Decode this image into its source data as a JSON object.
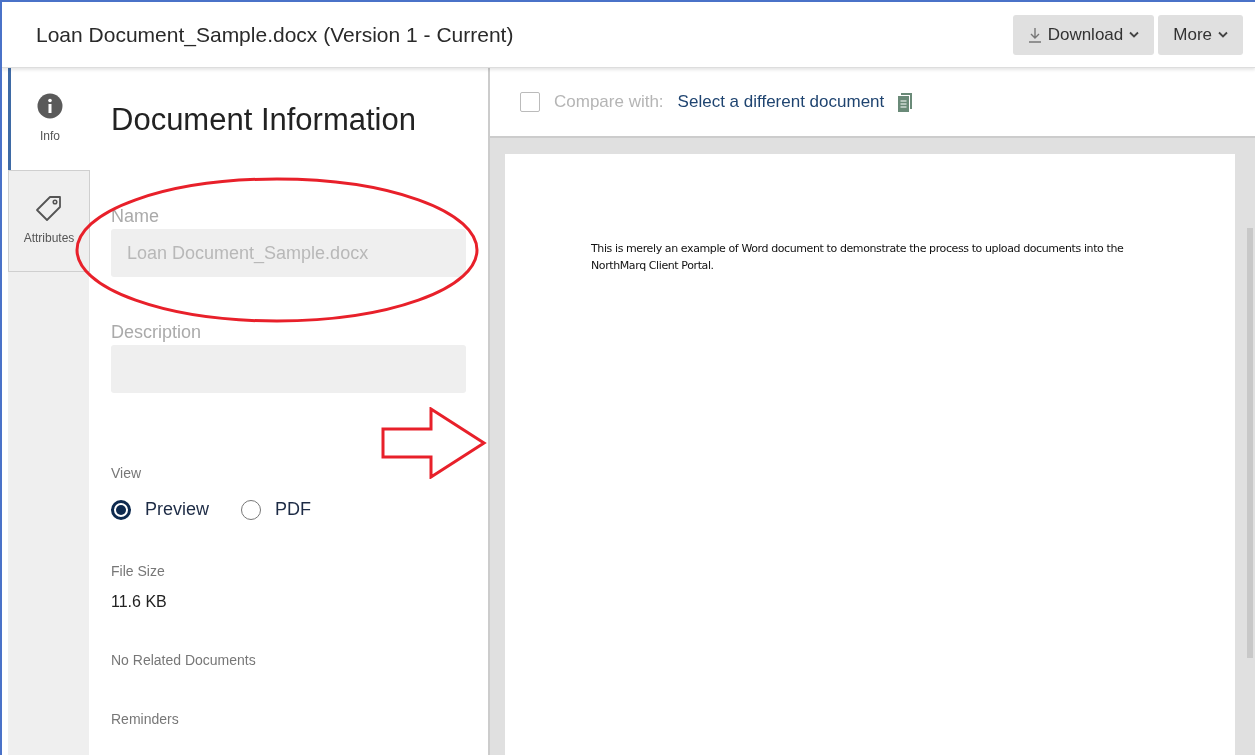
{
  "window": {
    "title": "Loan Document_Sample.docx (Version 1 - Current)"
  },
  "toolbar": [
    {
      "label": "Download",
      "kind": "download"
    },
    {
      "label": "More",
      "kind": "menu"
    }
  ],
  "tabs": [
    {
      "label": "Info",
      "kind": "info",
      "selected": true
    },
    {
      "label": "Attributes",
      "kind": "tag",
      "selected": false
    }
  ],
  "panel": {
    "heading": "Document Information",
    "fields": [
      {
        "label": "Name",
        "value": "Loan Document_Sample.docx",
        "disabled": true
      },
      {
        "label": "Description",
        "disabled": true
      }
    ],
    "view": {
      "label": "View",
      "options": [
        {
          "label": "Preview",
          "selected": true
        },
        {
          "label": "PDF",
          "selected": false
        }
      ]
    },
    "file_size": {
      "label": "File Size",
      "value": "11.6 KB"
    },
    "related": "No Related Documents",
    "reminders": "Reminders"
  },
  "compare": {
    "checked": false,
    "label": "Compare with:",
    "link": "Select a different document"
  },
  "document": {
    "text": "This is merely an example of Word document to demonstrate the process to upload documents into the NorthMarq Client Portal."
  }
}
